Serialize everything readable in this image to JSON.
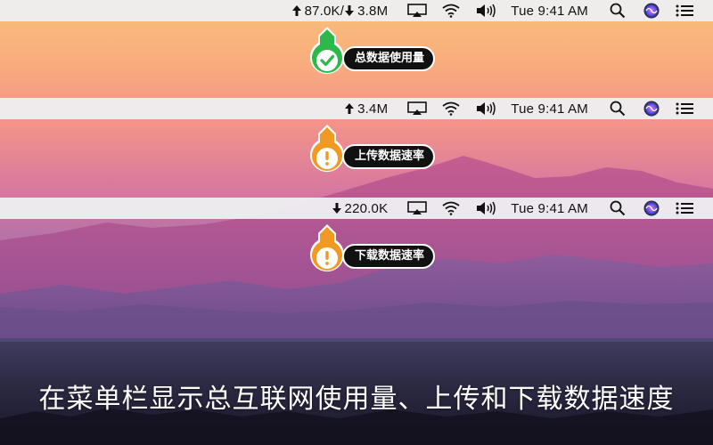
{
  "menubars": [
    {
      "net_items": [
        {
          "direction": "up",
          "value": "87.0K/"
        },
        {
          "direction": "down",
          "value": "3.8M"
        }
      ],
      "clock": "Tue 9:41 AM"
    },
    {
      "net_items": [
        {
          "direction": "up",
          "value": "3.4M"
        }
      ],
      "clock": "Tue 9:41 AM"
    },
    {
      "net_items": [
        {
          "direction": "down",
          "value": "220.0K"
        }
      ],
      "clock": "Tue 9:41 AM"
    }
  ],
  "menubar_icons": [
    "airplay-icon",
    "wifi-icon",
    "volume-icon",
    "clock",
    "spotlight-search-icon",
    "siri-icon",
    "notification-center-icon"
  ],
  "callouts": [
    {
      "label": "总数据使用量",
      "icon": "checkmark-icon",
      "color": "#2fb84a"
    },
    {
      "label": "上传数据速率",
      "icon": "exclamation-icon",
      "color": "#f09a24"
    },
    {
      "label": "下载数据速率",
      "icon": "exclamation-icon",
      "color": "#f09a24"
    }
  ],
  "caption": "在菜单栏显示总互联网使用量、上传和下载数据速度"
}
